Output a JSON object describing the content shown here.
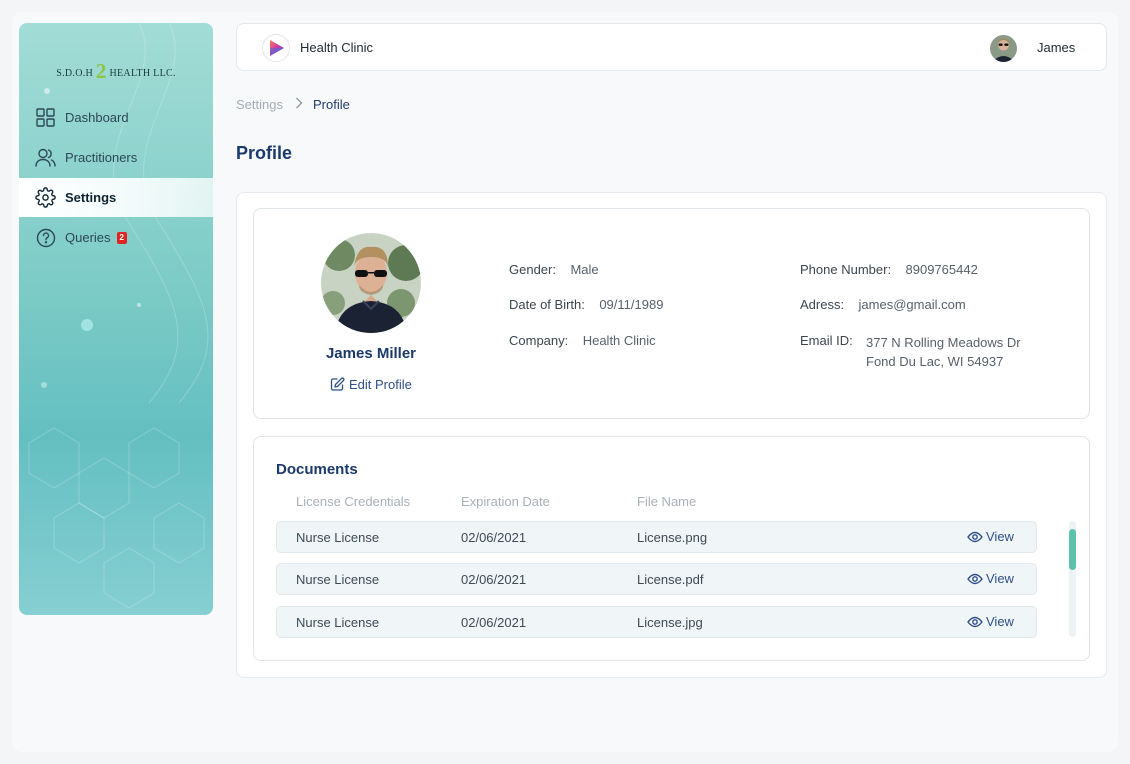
{
  "sidebar": {
    "logo_pre": "S.D.O.H",
    "logo_two": "2",
    "logo_post": "HEALTH LLC.",
    "items": [
      {
        "label": "Dashboard",
        "icon": "grid-icon"
      },
      {
        "label": "Practitioners",
        "icon": "users-icon"
      },
      {
        "label": "Settings",
        "icon": "gear-icon",
        "active": true
      },
      {
        "label": "Queries",
        "icon": "help-circle-icon",
        "badge": "2"
      }
    ]
  },
  "header": {
    "app_title": "Health Clinic",
    "user_name": "James"
  },
  "breadcrumb": {
    "parent": "Settings",
    "current": "Profile"
  },
  "page": {
    "title": "Profile"
  },
  "profile": {
    "name": "James Miller",
    "edit_label": "Edit Profile",
    "gender_label": "Gender:",
    "gender": "Male",
    "dob_label": "Date of Birth:",
    "dob": "09/11/1989",
    "company_label": "Company:",
    "company": "Health Clinic",
    "phone_label": "Phone Number:",
    "phone": "8909765442",
    "address_label": "Adress:",
    "address": "james@gmail.com",
    "email_label": "Email ID:",
    "email_line1": "377 N Rolling Meadows Dr",
    "email_line2": "Fond Du Lac, WI 54937"
  },
  "documents": {
    "title": "Documents",
    "columns": [
      "License Credentials",
      "Expiration Date",
      "File Name"
    ],
    "view_label": "View",
    "rows": [
      {
        "credential": "Nurse License",
        "expiration": "02/06/2021",
        "file": "License.png"
      },
      {
        "credential": "Nurse License",
        "expiration": "02/06/2021",
        "file": "License.pdf"
      },
      {
        "credential": "Nurse License",
        "expiration": "02/06/2021",
        "file": "License.jpg"
      }
    ]
  },
  "colors": {
    "accent": "#1b3a6b",
    "badge": "#e02424",
    "scroll_thumb": "#5ec2a8"
  }
}
